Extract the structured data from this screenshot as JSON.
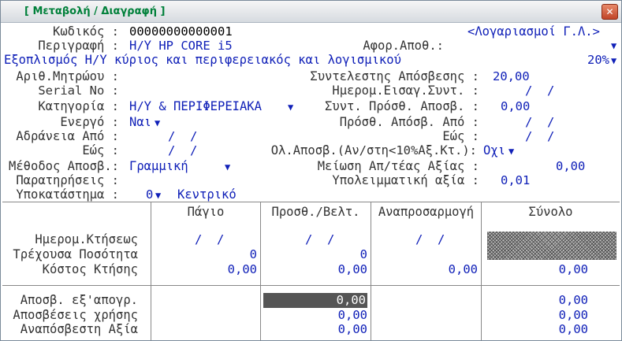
{
  "window": {
    "title": "[ Μεταβολή / Διαγραφή ]"
  },
  "icons": {
    "close": "close-icon",
    "dropdown": "triangle-down-icon"
  },
  "colors": {
    "title": "#00803a",
    "value": "#1020b8",
    "close": "#c04428"
  },
  "form": {
    "code_label": "Κωδικός :",
    "code_value": "00000000000001",
    "accounts_link": "<Λογαριασμοί Γ.Λ.>",
    "desc_label": "Περιγραφή :",
    "desc_value": "Η/Υ HP CORE i5",
    "afor_label": "Αφορ.Αποθ.:",
    "category_desc": "Εξοπλισμός Η/Υ κύριος και περιφερειακός και λογισμικού",
    "rate_value": "20%",
    "reg_label": "Αριθ.Μητρώου :",
    "dep_rate_label": "Συντελεστης Απόσβεσης :",
    "dep_rate_value": "20,00",
    "serial_label": "Serial No :",
    "import_date_label": "Ημερομ.Εισαγ.Συντ. :",
    "import_date_value": "/  /",
    "category_label": "Κατηγορία :",
    "category_value": "Η/Υ & ΠΕΡΙΦΕΡΕΙΑΚΑ",
    "add_rate_label": "Συντ. Πρόσθ. Αποσβ. :",
    "add_rate_value": "0,00",
    "active_label": "Ενεργό :",
    "active_value": "Ναι",
    "add_from_label": "Πρόσθ. Απόσβ. Από :",
    "add_from_value": "/  /",
    "inactive_from_label": "Αδράνεια Από :",
    "inactive_from_value": "/  /",
    "add_to_label": "Εώς :",
    "add_to_value": "/  /",
    "inactive_to_label": "Εώς :",
    "inactive_to_value": "/  /",
    "full_dep_label": "Ολ.Αποσβ.(Αν/στη<10%Αξ.Κτ.):",
    "full_dep_value": "Οχι",
    "method_label": "Μέθοδος Αποσβ.:",
    "method_value": "Γραμμική",
    "reduce_label": "Μείωση Απ/τέας Αξίας :",
    "reduce_value": "0,00",
    "notes_label": "Παρατηρήσεις :",
    "residual_label": "Υπολειμματική αξία :",
    "residual_value": "0,01",
    "branch_label": "Υποκατάστημα :",
    "branch_code": "0",
    "branch_name": "Κεντρικό"
  },
  "grid": {
    "columns": [
      "Πάγιο",
      "Προσθ./Βελτ.",
      "Αναπροσαρμογή",
      "Σύνολο"
    ],
    "rows1_labels": [
      "Ημερομ.Κτήσεως",
      "Τρέχουσα Ποσότητα",
      "Κόστος Κτήσης"
    ],
    "rows2_labels": [
      "Αποσβ. εξ'απογρ.",
      "Αποσβέσεις χρήσης",
      "Αναπόσβεστη Αξία"
    ],
    "acq_date": [
      "/  /",
      "/  /",
      "/  /"
    ],
    "qty": [
      "0",
      "0"
    ],
    "cost": [
      "0,00",
      "0,00",
      "0,00",
      "0,00"
    ],
    "dep_inv": [
      "0,00",
      "0,00"
    ],
    "dep_year": [
      "0,00",
      "0,00"
    ],
    "undep": [
      "0,00",
      "0,00"
    ]
  }
}
